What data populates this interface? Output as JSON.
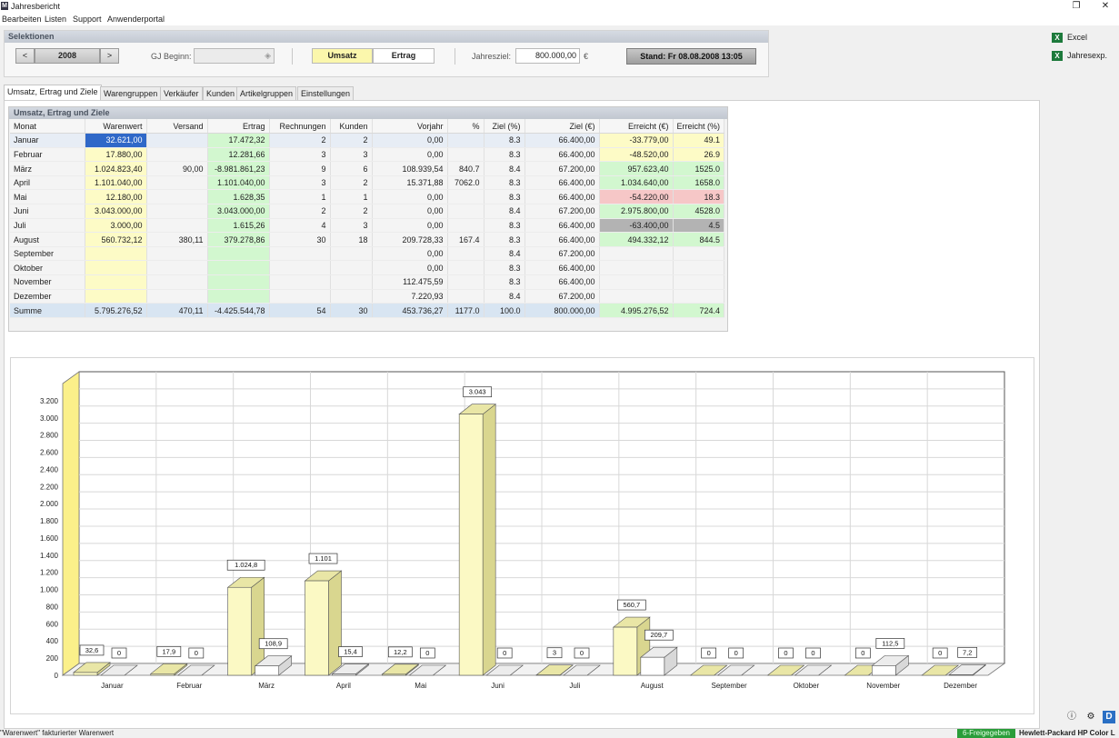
{
  "window": {
    "title": "Jahresbericht"
  },
  "menu": [
    "Bearbeiten",
    "Listen",
    "Support",
    "Anwenderportal"
  ],
  "selektionen": {
    "header": "Selektionen",
    "prev": "<",
    "year": "2008",
    "next": ">",
    "gj_label": "GJ Beginn:",
    "gj_value": "",
    "umsatz": "Umsatz",
    "ertrag": "Ertrag",
    "jahresziel_label": "Jahresziel:",
    "jahresziel_value": "800.000,00",
    "currency": "€",
    "stand": "Stand: Fr 08.08.2008 13:05"
  },
  "side": {
    "excel": "Excel",
    "jahresexp": "Jahresexp."
  },
  "tabs": [
    "Umsatz, Ertrag und Ziele",
    "Warengruppen",
    "Verkäufer",
    "Kunden",
    "Artikelgruppen",
    "Einstellungen"
  ],
  "table": {
    "title": "Umsatz, Ertrag und Ziele",
    "columns": [
      "Monat",
      "Warenwert",
      "Versand",
      "Ertrag",
      "Rechnungen",
      "Kunden",
      "Vorjahr",
      "%",
      "Ziel (%)",
      "Ziel (€)",
      "Erreicht (€)",
      "Erreicht (%)"
    ],
    "rows": [
      [
        "Januar",
        "32.621,00",
        "",
        "17.472,32",
        "2",
        "2",
        "0,00",
        "",
        "8.3",
        "66.400,00",
        "-33.779,00",
        "49.1"
      ],
      [
        "Februar",
        "17.880,00",
        "",
        "12.281,66",
        "3",
        "3",
        "0,00",
        "",
        "8.3",
        "66.400,00",
        "-48.520,00",
        "26.9"
      ],
      [
        "März",
        "1.024.823,40",
        "90,00",
        "-8.981.861,23",
        "9",
        "6",
        "108.939,54",
        "840.7",
        "8.4",
        "67.200,00",
        "957.623,40",
        "1525.0"
      ],
      [
        "April",
        "1.101.040,00",
        "",
        "1.101.040,00",
        "3",
        "2",
        "15.371,88",
        "7062.0",
        "8.3",
        "66.400,00",
        "1.034.640,00",
        "1658.0"
      ],
      [
        "Mai",
        "12.180,00",
        "",
        "1.628,35",
        "1",
        "1",
        "0,00",
        "",
        "8.3",
        "66.400,00",
        "-54.220,00",
        "18.3"
      ],
      [
        "Juni",
        "3.043.000,00",
        "",
        "3.043.000,00",
        "2",
        "2",
        "0,00",
        "",
        "8.4",
        "67.200,00",
        "2.975.800,00",
        "4528.0"
      ],
      [
        "Juli",
        "3.000,00",
        "",
        "1.615,26",
        "4",
        "3",
        "0,00",
        "",
        "8.3",
        "66.400,00",
        "-63.400,00",
        "4.5"
      ],
      [
        "August",
        "560.732,12",
        "380,11",
        "379.278,86",
        "30",
        "18",
        "209.728,33",
        "167.4",
        "8.3",
        "66.400,00",
        "494.332,12",
        "844.5"
      ],
      [
        "September",
        "",
        "",
        "",
        "",
        "",
        "0,00",
        "",
        "8.4",
        "67.200,00",
        "",
        ""
      ],
      [
        "Oktober",
        "",
        "",
        "",
        "",
        "",
        "0,00",
        "",
        "8.3",
        "66.400,00",
        "",
        ""
      ],
      [
        "November",
        "",
        "",
        "",
        "",
        "",
        "112.475,59",
        "",
        "8.3",
        "66.400,00",
        "",
        ""
      ],
      [
        "Dezember",
        "",
        "",
        "",
        "",
        "",
        "7.220,93",
        "",
        "8.4",
        "67.200,00",
        "",
        ""
      ]
    ],
    "sum": [
      "Summe",
      "5.795.276,52",
      "470,11",
      "-4.425.544,78",
      "54",
      "30",
      "453.736,27",
      "1177.0",
      "100.0",
      "800.000,00",
      "4.995.276,52",
      "724.4"
    ]
  },
  "chart_data": {
    "type": "bar",
    "categories": [
      "Januar",
      "Februar",
      "März",
      "April",
      "Mai",
      "Juni",
      "Juli",
      "August",
      "September",
      "Oktober",
      "November",
      "Dezember"
    ],
    "series": [
      {
        "values": [
          32.6,
          17.9,
          1024.8,
          1101,
          12.2,
          3043,
          3,
          560.7,
          0,
          0,
          0,
          0
        ],
        "labels": [
          "32,6",
          "17,9",
          "1.024,8",
          "1.101",
          "12,2",
          "3.043",
          "3",
          "560,7",
          "0",
          "0",
          "0",
          "0"
        ],
        "color": "#fbf9c4"
      },
      {
        "values": [
          0,
          0,
          108.9,
          15.4,
          0,
          0,
          0,
          209.7,
          0,
          0,
          112.5,
          7.2
        ],
        "labels": [
          "0",
          "0",
          "108,9",
          "15,4",
          "0",
          "0",
          "0",
          "209,7",
          "0",
          "0",
          "112,5",
          "7,2"
        ],
        "color": "#ffffff"
      }
    ],
    "yticks": [
      "0",
      "200",
      "400",
      "600",
      "800",
      "1.000",
      "1.200",
      "1.400",
      "1.600",
      "1.800",
      "2.000",
      "2.200",
      "2.400",
      "2.600",
      "2.800",
      "3.000",
      "3.200"
    ],
    "ylim": [
      0,
      3400
    ],
    "grid": true
  },
  "status": {
    "left": "\"Warenwert\" fakturierter Warenwert",
    "badge": "6-Freigegeben",
    "printer": "Hewlett-Packard HP Color L"
  }
}
